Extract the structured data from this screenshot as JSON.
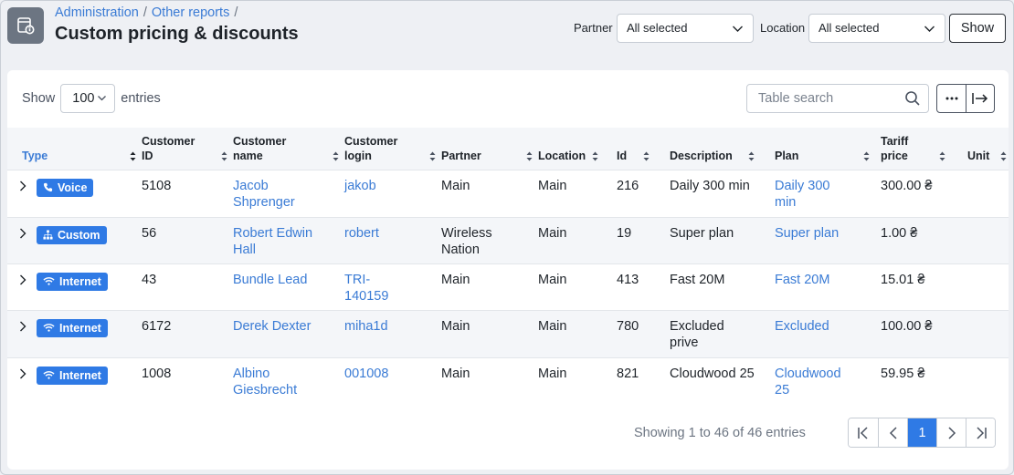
{
  "breadcrumb": {
    "items": [
      "Administration",
      "Other reports"
    ],
    "trailing_sep": "/"
  },
  "page": {
    "title": "Custom pricing & discounts"
  },
  "filters": {
    "partner_label": "Partner",
    "partner_value": "All selected",
    "location_label": "Location",
    "location_value": "All selected",
    "show_label": "Show"
  },
  "table_controls": {
    "show_label": "Show",
    "entries_value": "100",
    "entries_label": "entries",
    "search_placeholder": "Table search"
  },
  "columns": [
    {
      "label": "Type"
    },
    {
      "label": "Customer ID"
    },
    {
      "label": "Customer name"
    },
    {
      "label": "Customer login"
    },
    {
      "label": "Partner"
    },
    {
      "label": "Location"
    },
    {
      "label": "Id"
    },
    {
      "label": "Description"
    },
    {
      "label": "Plan"
    },
    {
      "label": "Tariff price"
    },
    {
      "label": "Unit"
    }
  ],
  "rows": [
    {
      "type": "Voice",
      "type_icon": "phone-icon",
      "customer_id": "5108",
      "customer_name": "Jacob Shprenger",
      "customer_login": "jakob",
      "partner": "Main",
      "location": "Main",
      "id": "216",
      "description": "Daily 300 min",
      "plan": "Daily 300 min",
      "tariff_price": "300.00 ₴",
      "unit": ""
    },
    {
      "type": "Custom",
      "type_icon": "sitemap-icon",
      "customer_id": "56",
      "customer_name": "Robert Edwin Hall",
      "customer_login": "robert",
      "partner": "Wireless Nation",
      "location": "Main",
      "id": "19",
      "description": "Super plan",
      "plan": "Super plan",
      "tariff_price": "1.00 ₴",
      "unit": ""
    },
    {
      "type": "Internet",
      "type_icon": "wifi-icon",
      "customer_id": "43",
      "customer_name": "Bundle Lead",
      "customer_login": "TRI-140159",
      "partner": "Main",
      "location": "Main",
      "id": "413",
      "description": "Fast 20M",
      "plan": "Fast 20M",
      "tariff_price": "15.01 ₴",
      "unit": ""
    },
    {
      "type": "Internet",
      "type_icon": "wifi-icon",
      "customer_id": "6172",
      "customer_name": "Derek Dexter",
      "customer_login": "miha1d",
      "partner": "Main",
      "location": "Main",
      "id": "780",
      "description": "Excluded prive",
      "plan": "Excluded",
      "tariff_price": "100.00 ₴",
      "unit": ""
    },
    {
      "type": "Internet",
      "type_icon": "wifi-icon",
      "customer_id": "1008",
      "customer_name": "Albino Giesbrecht",
      "customer_login": "001008",
      "partner": "Main",
      "location": "Main",
      "id": "821",
      "description": "Cloudwood 25",
      "plan": "Cloudwood 25",
      "tariff_price": "59.95 ₴",
      "unit": ""
    }
  ],
  "footer": {
    "showing_text": "Showing 1 to 46 of 46 entries",
    "current_page": "1"
  },
  "colors": {
    "accent": "#2f7ae5",
    "link": "#3a7bd5",
    "icon_bg": "#6c7582"
  }
}
